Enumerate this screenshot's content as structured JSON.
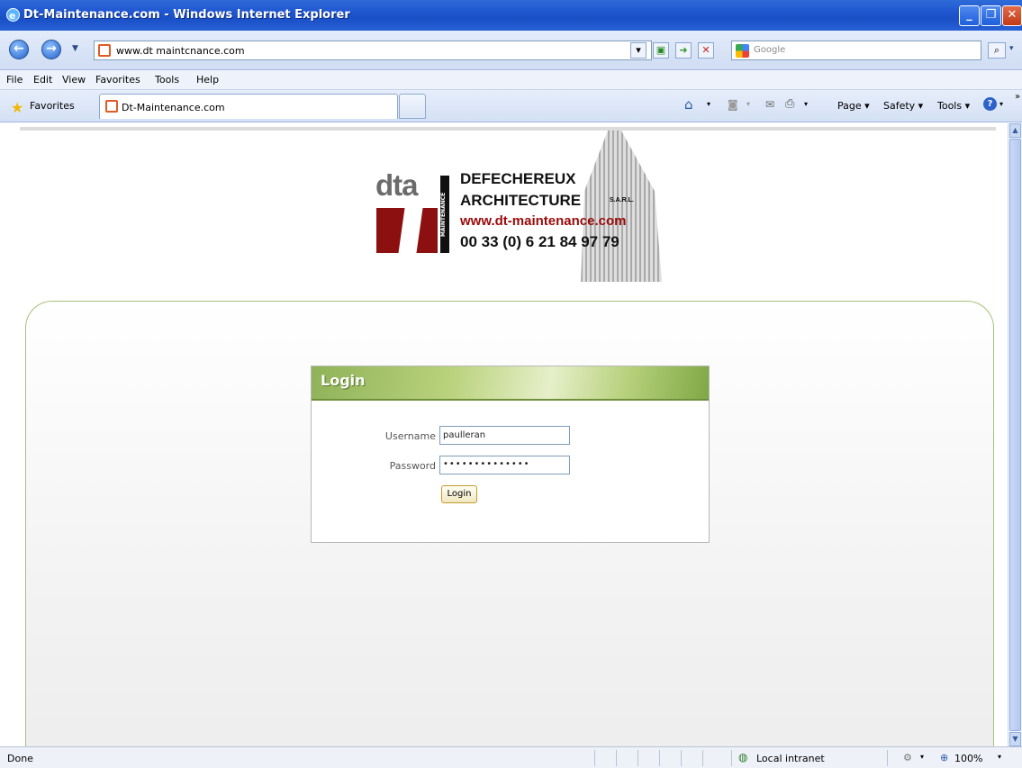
{
  "window": {
    "title": "Dt-Maintenance.com - Windows Internet Explorer",
    "controls": [
      "minimize-icon",
      "maximize-icon",
      "close-icon"
    ]
  },
  "address_bar": {
    "url": "www.dt maintcnance.com",
    "search_placeholder": "Google"
  },
  "menu": [
    "File",
    "Edit",
    "View",
    "Favorites",
    "Tools",
    "Help"
  ],
  "favorites_bar": {
    "favorites_label": "Favorites",
    "tab_title": "Dt-Maintenance.com",
    "commands": [
      "Page ▾",
      "Safety ▾",
      "Tools ▾"
    ]
  },
  "logo": {
    "brand": "dta",
    "vertical_text": "MAINTENANCE",
    "company_line1": "DEFECHEREUX",
    "company_line2": "ARCHITECTURE",
    "suffix": "S.A.R.L.",
    "website": "www.dt-maintenance.com",
    "phone": "00 33 (0) 6 21 84 97 79"
  },
  "login": {
    "header": "Login",
    "username_label": "Username",
    "username_value": "paulleran",
    "password_label": "Password",
    "password_value": "••••••••••••••",
    "submit_label": "Login"
  },
  "status_bar": {
    "status": "Done",
    "zone": "Local intranet",
    "zoom": "100%"
  }
}
